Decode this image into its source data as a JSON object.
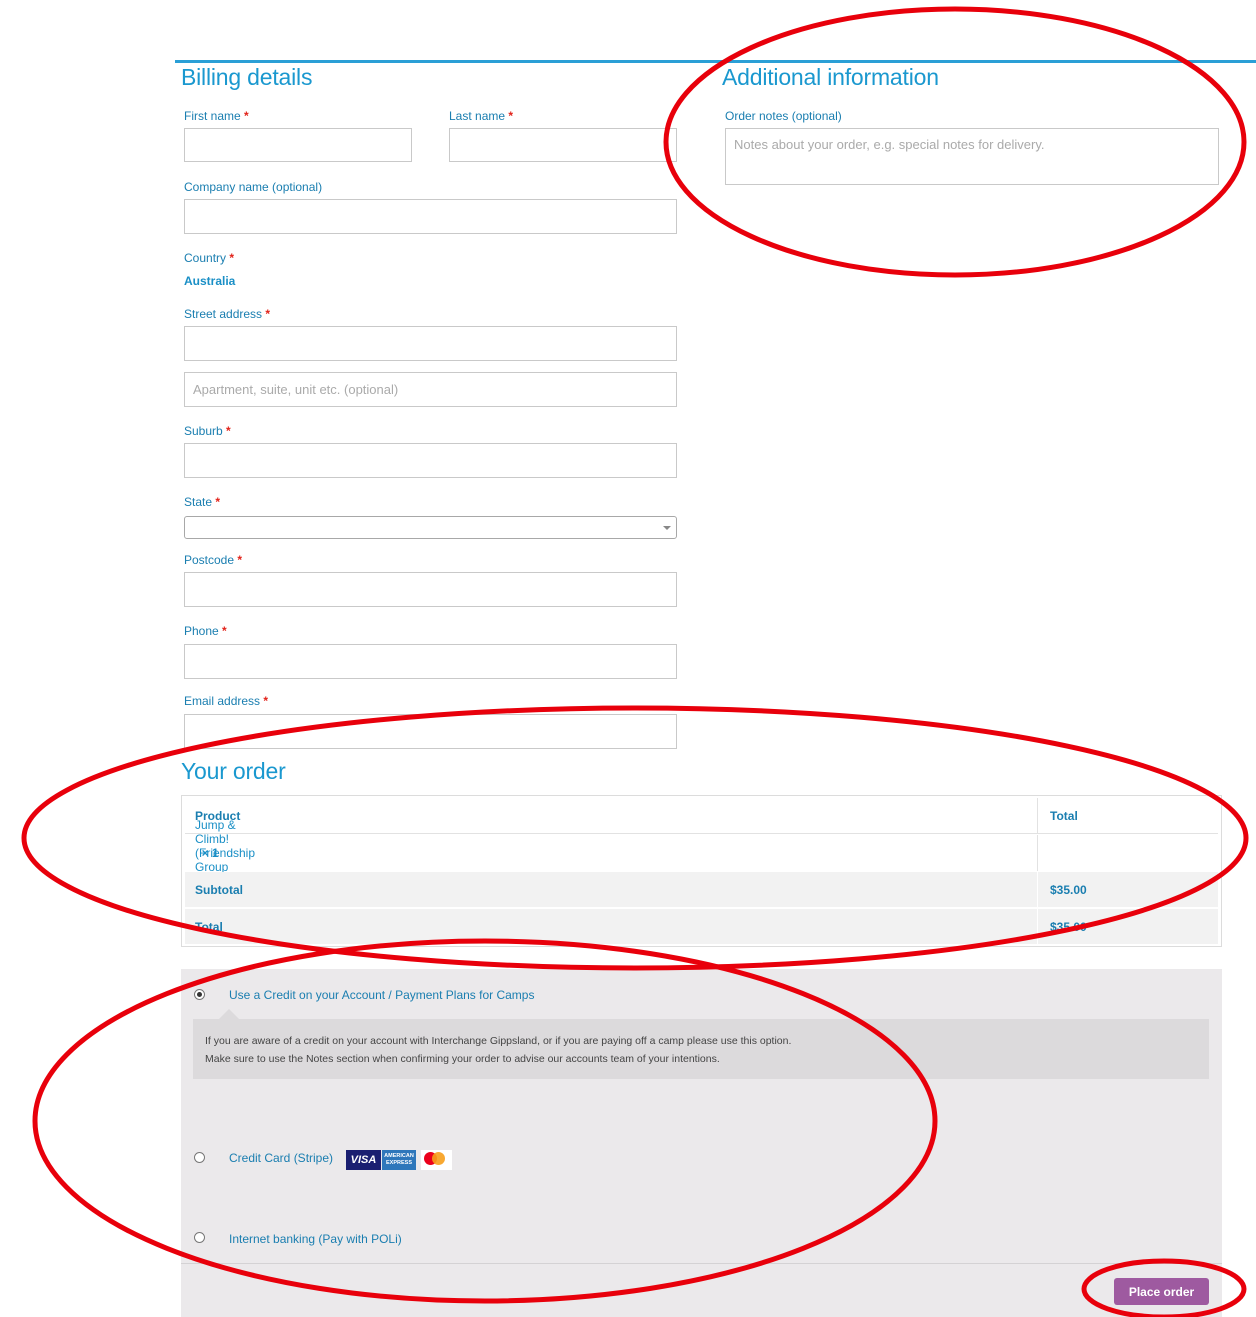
{
  "billing": {
    "title": "Billing details",
    "first_name_label": "First name",
    "last_name_label": "Last name",
    "company_label": "Company name (optional)",
    "country_label": "Country",
    "country_value": "Australia",
    "street_label": "Street address",
    "apartment_placeholder": "Apartment, suite, unit etc. (optional)",
    "suburb_label": "Suburb",
    "state_label": "State",
    "postcode_label": "Postcode",
    "phone_label": "Phone",
    "email_label": "Email address",
    "required_mark": "*"
  },
  "additional": {
    "title": "Additional information",
    "notes_label": "Order notes (optional)",
    "notes_placeholder": "Notes about your order, e.g. special notes for delivery."
  },
  "order": {
    "title": "Your order",
    "col_product": "Product",
    "col_total": "Total",
    "items": [
      {
        "name": "Jump & Climb! (Friendship Group Latrobe)",
        "qty": "× 1"
      }
    ],
    "subtotal_label": "Subtotal",
    "subtotal_value": "$35.00",
    "total_label": "Total",
    "total_value": "$35.00"
  },
  "payment": {
    "methods": [
      {
        "label": "Use a Credit on your Account / Payment Plans for Camps",
        "selected": true,
        "description_line1": "If you are aware of a credit on your account with Interchange Gippsland, or if you are paying off a camp please use this option.",
        "description_line2": "Make sure to use the Notes section when confirming your order to advise our accounts team of your intentions."
      },
      {
        "label": "Credit Card (Stripe)",
        "selected": false,
        "cards": [
          "visa",
          "american-express",
          "mastercard"
        ]
      },
      {
        "label": "Internet banking (Pay with POLi)",
        "selected": false
      }
    ],
    "card_visa": "VISA",
    "card_amex_line1": "AMERICAN",
    "card_amex_line2": "EXPRESS",
    "place_order": "Place order"
  },
  "colors": {
    "heading": "#1a98cf",
    "label": "#1a7eb0",
    "required": "#e2231a",
    "button": "#9e5aa0",
    "annotation": "#e8000b"
  }
}
